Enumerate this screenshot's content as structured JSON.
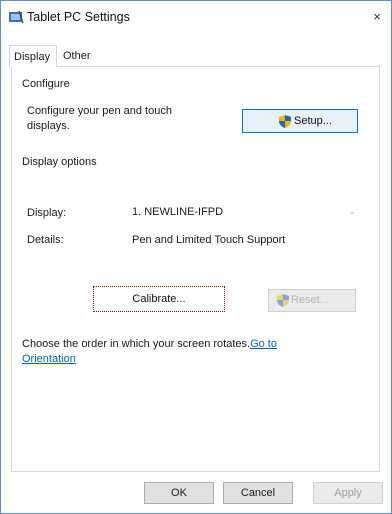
{
  "window": {
    "title": "Tablet PC Settings",
    "close_glyph": "×"
  },
  "tabs": [
    {
      "label": "Display",
      "active": true
    },
    {
      "label": "Other",
      "active": false
    }
  ],
  "configure": {
    "heading": "Configure",
    "description_line1": "Configure your pen and touch",
    "description_line2": "displays.",
    "setup_label": "Setup..."
  },
  "display_options": {
    "heading": "Display options",
    "display_label": "Display:",
    "display_value": "1. NEWLINE-IFPD",
    "details_label": "Details:",
    "details_value": "Pen and Limited Touch Support",
    "calibrate_label": "Calibrate...",
    "reset_label": "Reset..."
  },
  "orientation": {
    "text": "Choose the order in which your screen rotates.",
    "link_part1": "Go to",
    "link_part2": "Orientation"
  },
  "footer": {
    "ok": "OK",
    "cancel": "Cancel",
    "apply": "Apply"
  },
  "icons": {
    "title": "tablet-pc-icon",
    "setup": "uac-shield-icon",
    "reset": "uac-shield-icon"
  },
  "colors": {
    "accent": "#0078d7",
    "link": "#0066cc",
    "focus_outline": "#c00000",
    "border": "#5f8fc7"
  }
}
